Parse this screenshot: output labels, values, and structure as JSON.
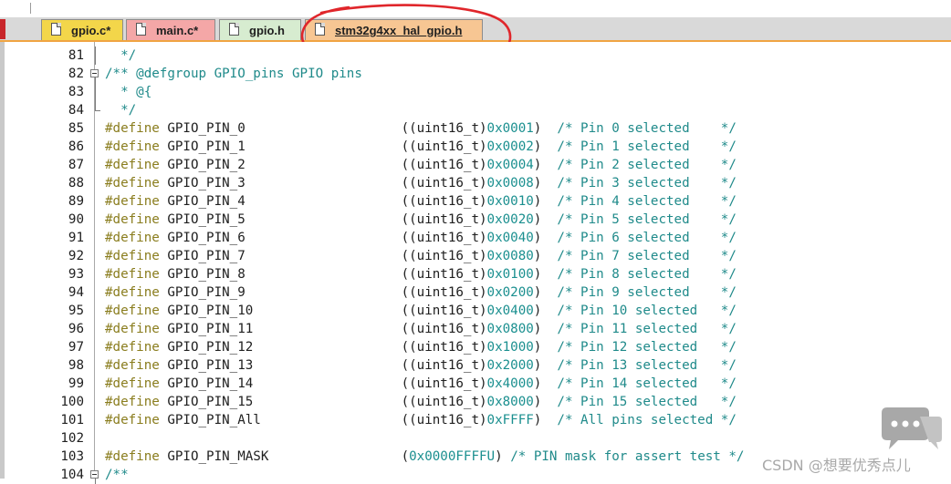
{
  "tabs": [
    {
      "label": "gpio.c*",
      "active": false
    },
    {
      "label": "main.c*",
      "active": false
    },
    {
      "label": "gpio.h",
      "active": false
    },
    {
      "label": "stm32g4xx_hal_gpio.h",
      "active": true
    }
  ],
  "colors": {
    "keyword": "#8a7d1e",
    "comment": "#1f8a8a",
    "hex": "#1a8f8f",
    "annotation": "#e0262b",
    "active_tab": "#f7c693"
  },
  "editor": {
    "lines": [
      {
        "num": "81",
        "fold": "line",
        "parts": [
          {
            "t": "  */",
            "c": "cm"
          }
        ]
      },
      {
        "num": "82",
        "fold": "box",
        "parts": [
          {
            "t": "/** @defgroup GPIO_pins GPIO pins",
            "c": "cm"
          }
        ]
      },
      {
        "num": "83",
        "fold": "line",
        "parts": [
          {
            "t": "  * @{",
            "c": "cm"
          }
        ]
      },
      {
        "num": "84",
        "fold": "end",
        "parts": [
          {
            "t": "  */",
            "c": "cm"
          }
        ]
      },
      {
        "num": "85",
        "fold": "",
        "parts": [
          {
            "t": "#define",
            "c": "kw"
          },
          {
            "t": " GPIO_PIN_0                    ((uint16_t)",
            "c": "plain"
          },
          {
            "t": "0x0001",
            "c": "hex"
          },
          {
            "t": ")  ",
            "c": "plain"
          },
          {
            "t": "/* Pin 0 selected    */",
            "c": "cm"
          }
        ]
      },
      {
        "num": "86",
        "fold": "",
        "parts": [
          {
            "t": "#define",
            "c": "kw"
          },
          {
            "t": " GPIO_PIN_1                    ((uint16_t)",
            "c": "plain"
          },
          {
            "t": "0x0002",
            "c": "hex"
          },
          {
            "t": ")  ",
            "c": "plain"
          },
          {
            "t": "/* Pin 1 selected    */",
            "c": "cm"
          }
        ]
      },
      {
        "num": "87",
        "fold": "",
        "parts": [
          {
            "t": "#define",
            "c": "kw"
          },
          {
            "t": " GPIO_PIN_2                    ((uint16_t)",
            "c": "plain"
          },
          {
            "t": "0x0004",
            "c": "hex"
          },
          {
            "t": ")  ",
            "c": "plain"
          },
          {
            "t": "/* Pin 2 selected    */",
            "c": "cm"
          }
        ]
      },
      {
        "num": "88",
        "fold": "",
        "parts": [
          {
            "t": "#define",
            "c": "kw"
          },
          {
            "t": " GPIO_PIN_3                    ((uint16_t)",
            "c": "plain"
          },
          {
            "t": "0x0008",
            "c": "hex"
          },
          {
            "t": ")  ",
            "c": "plain"
          },
          {
            "t": "/* Pin 3 selected    */",
            "c": "cm"
          }
        ]
      },
      {
        "num": "89",
        "fold": "",
        "parts": [
          {
            "t": "#define",
            "c": "kw"
          },
          {
            "t": " GPIO_PIN_4                    ((uint16_t)",
            "c": "plain"
          },
          {
            "t": "0x0010",
            "c": "hex"
          },
          {
            "t": ")  ",
            "c": "plain"
          },
          {
            "t": "/* Pin 4 selected    */",
            "c": "cm"
          }
        ]
      },
      {
        "num": "90",
        "fold": "",
        "parts": [
          {
            "t": "#define",
            "c": "kw"
          },
          {
            "t": " GPIO_PIN_5                    ((uint16_t)",
            "c": "plain"
          },
          {
            "t": "0x0020",
            "c": "hex"
          },
          {
            "t": ")  ",
            "c": "plain"
          },
          {
            "t": "/* Pin 5 selected    */",
            "c": "cm"
          }
        ]
      },
      {
        "num": "91",
        "fold": "",
        "parts": [
          {
            "t": "#define",
            "c": "kw"
          },
          {
            "t": " GPIO_PIN_6                    ((uint16_t)",
            "c": "plain"
          },
          {
            "t": "0x0040",
            "c": "hex"
          },
          {
            "t": ")  ",
            "c": "plain"
          },
          {
            "t": "/* Pin 6 selected    */",
            "c": "cm"
          }
        ]
      },
      {
        "num": "92",
        "fold": "",
        "parts": [
          {
            "t": "#define",
            "c": "kw"
          },
          {
            "t": " GPIO_PIN_7                    ((uint16_t)",
            "c": "plain"
          },
          {
            "t": "0x0080",
            "c": "hex"
          },
          {
            "t": ")  ",
            "c": "plain"
          },
          {
            "t": "/* Pin 7 selected    */",
            "c": "cm"
          }
        ]
      },
      {
        "num": "93",
        "fold": "",
        "parts": [
          {
            "t": "#define",
            "c": "kw"
          },
          {
            "t": " GPIO_PIN_8                    ((uint16_t)",
            "c": "plain"
          },
          {
            "t": "0x0100",
            "c": "hex"
          },
          {
            "t": ")  ",
            "c": "plain"
          },
          {
            "t": "/* Pin 8 selected    */",
            "c": "cm"
          }
        ]
      },
      {
        "num": "94",
        "fold": "",
        "parts": [
          {
            "t": "#define",
            "c": "kw"
          },
          {
            "t": " GPIO_PIN_9                    ((uint16_t)",
            "c": "plain"
          },
          {
            "t": "0x0200",
            "c": "hex"
          },
          {
            "t": ")  ",
            "c": "plain"
          },
          {
            "t": "/* Pin 9 selected    */",
            "c": "cm"
          }
        ]
      },
      {
        "num": "95",
        "fold": "",
        "parts": [
          {
            "t": "#define",
            "c": "kw"
          },
          {
            "t": " GPIO_PIN_10                   ((uint16_t)",
            "c": "plain"
          },
          {
            "t": "0x0400",
            "c": "hex"
          },
          {
            "t": ")  ",
            "c": "plain"
          },
          {
            "t": "/* Pin 10 selected   */",
            "c": "cm"
          }
        ]
      },
      {
        "num": "96",
        "fold": "",
        "parts": [
          {
            "t": "#define",
            "c": "kw"
          },
          {
            "t": " GPIO_PIN_11                   ((uint16_t)",
            "c": "plain"
          },
          {
            "t": "0x0800",
            "c": "hex"
          },
          {
            "t": ")  ",
            "c": "plain"
          },
          {
            "t": "/* Pin 11 selected   */",
            "c": "cm"
          }
        ]
      },
      {
        "num": "97",
        "fold": "",
        "parts": [
          {
            "t": "#define",
            "c": "kw"
          },
          {
            "t": " GPIO_PIN_12                   ((uint16_t)",
            "c": "plain"
          },
          {
            "t": "0x1000",
            "c": "hex"
          },
          {
            "t": ")  ",
            "c": "plain"
          },
          {
            "t": "/* Pin 12 selected   */",
            "c": "cm"
          }
        ]
      },
      {
        "num": "98",
        "fold": "",
        "parts": [
          {
            "t": "#define",
            "c": "kw"
          },
          {
            "t": " GPIO_PIN_13                   ((uint16_t)",
            "c": "plain"
          },
          {
            "t": "0x2000",
            "c": "hex"
          },
          {
            "t": ")  ",
            "c": "plain"
          },
          {
            "t": "/* Pin 13 selected   */",
            "c": "cm"
          }
        ]
      },
      {
        "num": "99",
        "fold": "",
        "parts": [
          {
            "t": "#define",
            "c": "kw"
          },
          {
            "t": " GPIO_PIN_14                   ((uint16_t)",
            "c": "plain"
          },
          {
            "t": "0x4000",
            "c": "hex"
          },
          {
            "t": ")  ",
            "c": "plain"
          },
          {
            "t": "/* Pin 14 selected   */",
            "c": "cm"
          }
        ]
      },
      {
        "num": "100",
        "fold": "",
        "parts": [
          {
            "t": "#define",
            "c": "kw"
          },
          {
            "t": " GPIO_PIN_15                   ((uint16_t)",
            "c": "plain"
          },
          {
            "t": "0x8000",
            "c": "hex"
          },
          {
            "t": ")  ",
            "c": "plain"
          },
          {
            "t": "/* Pin 15 selected   */",
            "c": "cm"
          }
        ]
      },
      {
        "num": "101",
        "fold": "",
        "parts": [
          {
            "t": "#define",
            "c": "kw"
          },
          {
            "t": " GPIO_PIN_All                  ((uint16_t)",
            "c": "plain"
          },
          {
            "t": "0xFFFF",
            "c": "hex"
          },
          {
            "t": ")  ",
            "c": "plain"
          },
          {
            "t": "/* All pins selected */",
            "c": "cm"
          }
        ]
      },
      {
        "num": "102",
        "fold": "",
        "parts": []
      },
      {
        "num": "103",
        "fold": "",
        "parts": [
          {
            "t": "#define",
            "c": "kw"
          },
          {
            "t": " GPIO_PIN_MASK                 (",
            "c": "plain"
          },
          {
            "t": "0x0000FFFFU",
            "c": "hex"
          },
          {
            "t": ") ",
            "c": "plain"
          },
          {
            "t": "/* PIN mask for assert test */",
            "c": "cm"
          }
        ]
      },
      {
        "num": "104",
        "fold": "box",
        "parts": [
          {
            "t": "/**",
            "c": "cm"
          }
        ]
      }
    ]
  },
  "watermark": {
    "text": "CSDN @想要优秀点儿"
  }
}
